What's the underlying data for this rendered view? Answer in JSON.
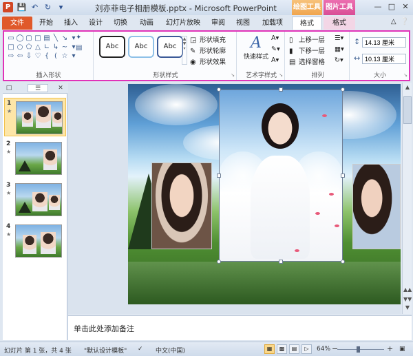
{
  "titlebar": {
    "app_icon": "P",
    "qat_icons": [
      "save-icon",
      "undo-icon",
      "redo-icon",
      "customize-icon"
    ],
    "title": "刘亦菲电子相册模板.pptx - Microsoft PowerPoint",
    "ctx_drawing_tools": "绘图工具",
    "ctx_picture_tools": "图片工具",
    "window_buttons": [
      "minimize",
      "maximize",
      "close"
    ]
  },
  "tabs": {
    "file": "文件",
    "home": "开始",
    "insert": "插入",
    "design": "设计",
    "transitions": "切换",
    "animations": "动画",
    "slideshow": "幻灯片放映",
    "review": "审阅",
    "view": "视图",
    "addins": "加载项",
    "format_drawing": "格式",
    "format_picture": "格式"
  },
  "ribbon": {
    "insert_shapes": {
      "label": "插入形状"
    },
    "shape_styles": {
      "label": "形状样式",
      "preset_text": "Abc",
      "fill": "形状填充",
      "outline": "形状轮廓",
      "effects": "形状效果"
    },
    "wordart": {
      "label": "艺术字样式",
      "quick_styles": "快速样式"
    },
    "arrange": {
      "label": "排列",
      "bring_forward": "上移一层",
      "send_backward": "下移一层",
      "selection_pane": "选择窗格"
    },
    "size": {
      "label": "大小",
      "height": "14.13 厘米",
      "width": "10.13 厘米"
    }
  },
  "slides_pane": {
    "slides": [
      {
        "num": "1",
        "selected": true
      },
      {
        "num": "2",
        "selected": false
      },
      {
        "num": "3",
        "selected": false
      },
      {
        "num": "4",
        "selected": false
      }
    ]
  },
  "notes": {
    "placeholder": "单击此处添加备注"
  },
  "status": {
    "slide_info": "幻灯片 第 1 张，共 4 张",
    "theme": "\"默认设计模板\"",
    "language": "中文(中国)",
    "zoom": "64%",
    "zoom_level_percent": 64
  },
  "colors": {
    "file_tab": "#e0592a",
    "drawing_tools": "#f0a54e",
    "picture_tools": "#d94c95",
    "ribbon_highlight": "#e032b8"
  }
}
